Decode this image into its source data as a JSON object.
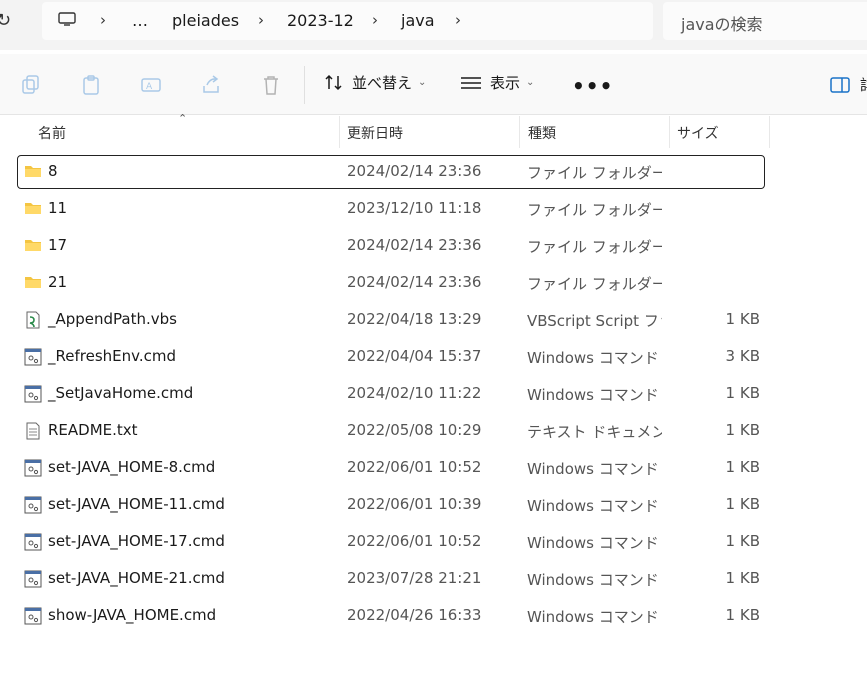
{
  "address": {
    "breadcrumbs": [
      "…",
      "pleiades",
      "2023-12",
      "java"
    ],
    "search_placeholder": "javaの検索"
  },
  "toolbar": {
    "sort_label": "並べ替え",
    "view_label": "表示",
    "more_label": "•••",
    "details_label": "詳"
  },
  "columns": {
    "name": "名前",
    "date": "更新日時",
    "type": "種類",
    "size": "サイズ"
  },
  "files": [
    {
      "name": "8",
      "date": "2024/02/14 23:36",
      "type": "ファイル フォルダー",
      "size": "",
      "icon": "folder-icon"
    },
    {
      "name": "11",
      "date": "2023/12/10 11:18",
      "type": "ファイル フォルダー",
      "size": "",
      "icon": "folder-icon"
    },
    {
      "name": "17",
      "date": "2024/02/14 23:36",
      "type": "ファイル フォルダー",
      "size": "",
      "icon": "folder-icon"
    },
    {
      "name": "21",
      "date": "2024/02/14 23:36",
      "type": "ファイル フォルダー",
      "size": "",
      "icon": "folder-icon"
    },
    {
      "name": "_AppendPath.vbs",
      "date": "2022/04/18 13:29",
      "type": "VBScript Script ファ...",
      "size": "1 KB",
      "icon": "vbscript-icon"
    },
    {
      "name": "_RefreshEnv.cmd",
      "date": "2022/04/04 15:37",
      "type": "Windows コマンド ス...",
      "size": "3 KB",
      "icon": "cmd-file-icon"
    },
    {
      "name": "_SetJavaHome.cmd",
      "date": "2024/02/10 11:22",
      "type": "Windows コマンド ス...",
      "size": "1 KB",
      "icon": "cmd-file-icon"
    },
    {
      "name": "README.txt",
      "date": "2022/05/08 10:29",
      "type": "テキスト ドキュメント",
      "size": "1 KB",
      "icon": "text-file-icon"
    },
    {
      "name": "set-JAVA_HOME-8.cmd",
      "date": "2022/06/01 10:52",
      "type": "Windows コマンド ス...",
      "size": "1 KB",
      "icon": "cmd-file-icon"
    },
    {
      "name": "set-JAVA_HOME-11.cmd",
      "date": "2022/06/01 10:39",
      "type": "Windows コマンド ス...",
      "size": "1 KB",
      "icon": "cmd-file-icon"
    },
    {
      "name": "set-JAVA_HOME-17.cmd",
      "date": "2022/06/01 10:52",
      "type": "Windows コマンド ス...",
      "size": "1 KB",
      "icon": "cmd-file-icon"
    },
    {
      "name": "set-JAVA_HOME-21.cmd",
      "date": "2023/07/28 21:21",
      "type": "Windows コマンド ス...",
      "size": "1 KB",
      "icon": "cmd-file-icon"
    },
    {
      "name": "show-JAVA_HOME.cmd",
      "date": "2022/04/26 16:33",
      "type": "Windows コマンド ス...",
      "size": "1 KB",
      "icon": "cmd-file-icon"
    }
  ],
  "selected_index": 0
}
